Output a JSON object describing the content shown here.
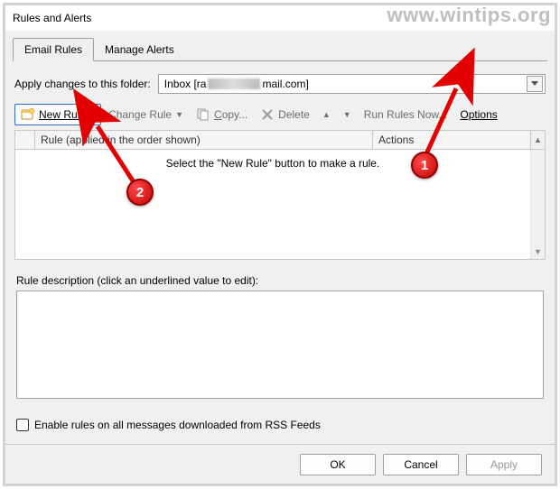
{
  "window": {
    "title": "Rules and Alerts"
  },
  "tabs": {
    "email_rules": "Email Rules",
    "manage_alerts": "Manage Alerts"
  },
  "folder": {
    "label": "Apply changes to this folder:",
    "value_prefix": "Inbox [ra",
    "value_suffix": "mail.com]"
  },
  "toolbar": {
    "new_rule": "New Rule...",
    "change_rule": "Change Rule",
    "copy": "Copy...",
    "delete": "Delete",
    "run_rules": "Run Rules Now...",
    "options": "Options"
  },
  "grid": {
    "col_rule": "Rule (applied in the order shown)",
    "col_actions": "Actions",
    "empty_text": "Select the \"New Rule\" button to make a rule."
  },
  "description": {
    "label": "Rule description (click an underlined value to edit):"
  },
  "rss": {
    "label": "Enable rules on all messages downloaded from RSS Feeds",
    "checked": false
  },
  "buttons": {
    "ok": "OK",
    "cancel": "Cancel",
    "apply": "Apply"
  },
  "overlay": {
    "watermark": "www.wintips.org",
    "marker1": "1",
    "marker2": "2"
  }
}
